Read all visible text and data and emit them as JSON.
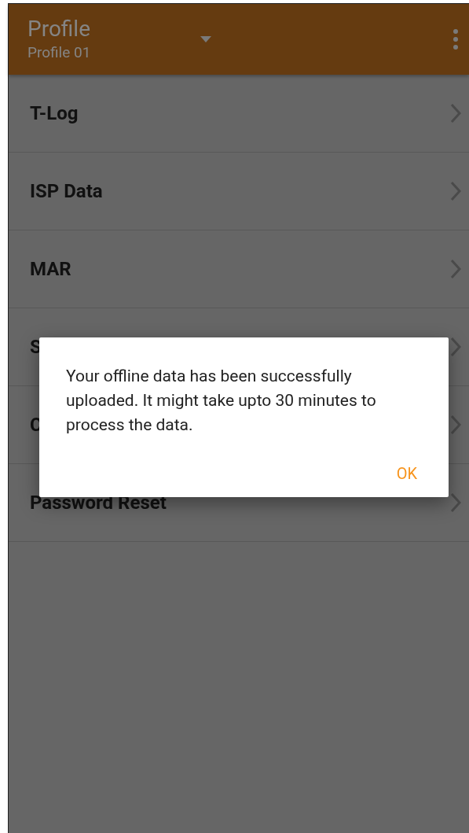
{
  "app_bar": {
    "title": "Profile",
    "subtitle": "Profile 01"
  },
  "menu_items": [
    {
      "label": "T-Log"
    },
    {
      "label": "ISP Data"
    },
    {
      "label": "MAR"
    },
    {
      "label": "S"
    },
    {
      "label": "C"
    },
    {
      "label": "Password Reset"
    }
  ],
  "dialog": {
    "message": "Your offline data has been successfully uploaded. It might take upto 30 minutes to process the data.",
    "button": "OK"
  }
}
